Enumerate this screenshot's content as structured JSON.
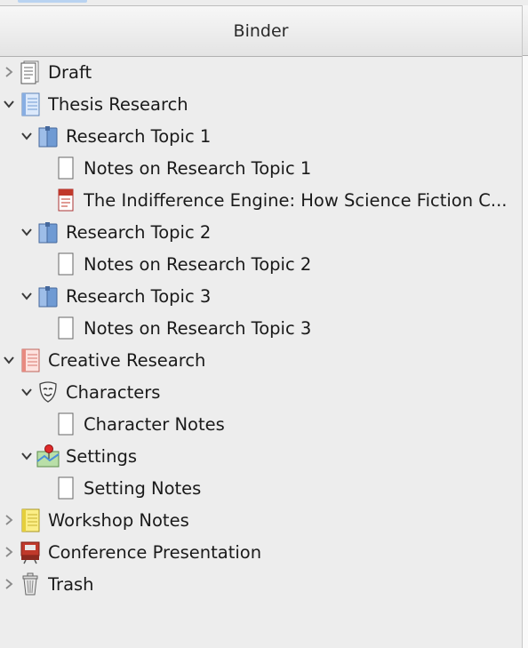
{
  "binder": {
    "title": "Binder",
    "items": [
      {
        "label": "Draft",
        "icon": "draft-document-icon",
        "state": "collapsed"
      },
      {
        "label": "Thesis Research",
        "icon": "blue-notebook-icon",
        "state": "expanded"
      },
      {
        "label": "Research Topic 1",
        "icon": "blue-folder-icon",
        "state": "expanded"
      },
      {
        "label": "Notes on Research Topic 1",
        "icon": "blank-page-icon"
      },
      {
        "label": "The Indifference Engine: How Science Fiction C...",
        "icon": "pdf-document-icon"
      },
      {
        "label": "Research Topic 2",
        "icon": "blue-folder-icon",
        "state": "expanded"
      },
      {
        "label": "Notes on Research Topic 2",
        "icon": "blank-page-icon"
      },
      {
        "label": "Research Topic 3",
        "icon": "blue-folder-icon",
        "state": "expanded"
      },
      {
        "label": "Notes on Research Topic 3",
        "icon": "blank-page-icon"
      },
      {
        "label": "Creative Research",
        "icon": "red-notebook-icon",
        "state": "expanded"
      },
      {
        "label": "Characters",
        "icon": "theater-mask-icon",
        "state": "expanded"
      },
      {
        "label": "Character Notes",
        "icon": "blank-page-icon"
      },
      {
        "label": "Settings",
        "icon": "map-pin-icon",
        "state": "expanded"
      },
      {
        "label": "Setting Notes",
        "icon": "blank-page-icon"
      },
      {
        "label": "Workshop Notes",
        "icon": "yellow-notepad-icon",
        "state": "collapsed"
      },
      {
        "label": "Conference Presentation",
        "icon": "presentation-board-icon",
        "state": "collapsed"
      },
      {
        "label": "Trash",
        "icon": "trash-can-icon",
        "state": "collapsed"
      }
    ]
  },
  "colors": {
    "panel_background": "#ededed",
    "folder_blue": "#6f9ad3",
    "pdf_red": "#c0392b"
  }
}
